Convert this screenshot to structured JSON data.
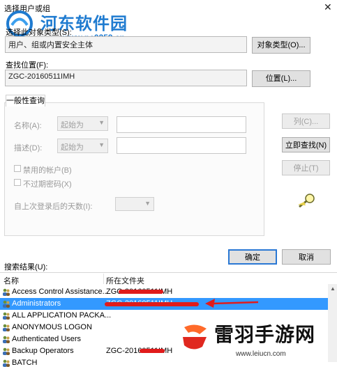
{
  "window": {
    "title": "选择用户或组",
    "close_glyph": "✕"
  },
  "watermark": {
    "site_name": "河东软件园",
    "url": "www.pc0359.cn"
  },
  "object_types": {
    "label": "选择此对象类型(S):",
    "value": "用户、组或内置安全主体",
    "button": "对象类型(O)..."
  },
  "location": {
    "label": "查找位置(F):",
    "value": "ZGC-20160511IMH",
    "button": "位置(L)..."
  },
  "general_query": {
    "tab_label": "一般性查询",
    "name_label": "名称(A):",
    "name_mode": "起始为",
    "description_label": "描述(D):",
    "description_mode": "起始为",
    "disabled_accounts": "禁用的帐户(B)",
    "non_expiring_password": "不过期密码(X)",
    "days_since_logon_label": "自上次登录后的天数(I):"
  },
  "side_buttons": {
    "columns": "列(C)...",
    "find_now": "立即查找(N)",
    "stop": "停止(T)"
  },
  "dialog_buttons": {
    "ok": "确定",
    "cancel": "取消"
  },
  "results": {
    "label": "搜索结果(U):",
    "columns": [
      "名称",
      "所在文件夹"
    ],
    "rows": [
      {
        "name": "Access Control Assistance...",
        "folder": "ZGC-20160511IMH"
      },
      {
        "name": "Administrators",
        "folder": "ZGC-20160511IMH",
        "selected": true
      },
      {
        "name": "ALL APPLICATION PACKA...",
        "folder": ""
      },
      {
        "name": "ANONYMOUS LOGON",
        "folder": ""
      },
      {
        "name": "Authenticated Users",
        "folder": ""
      },
      {
        "name": "Backup Operators",
        "folder": "ZGC-20160511IMH"
      },
      {
        "name": "BATCH",
        "folder": ""
      }
    ]
  },
  "logo_watermark": {
    "text": "雷羽手游网",
    "url": "www.leiucn.com"
  },
  "colors": {
    "selection": "#3399ff",
    "arrow": "#e11b1b",
    "watermark_blue": "#1f7bd0",
    "logo_orange": "#ff6a2a",
    "logo_red": "#e0281f"
  }
}
